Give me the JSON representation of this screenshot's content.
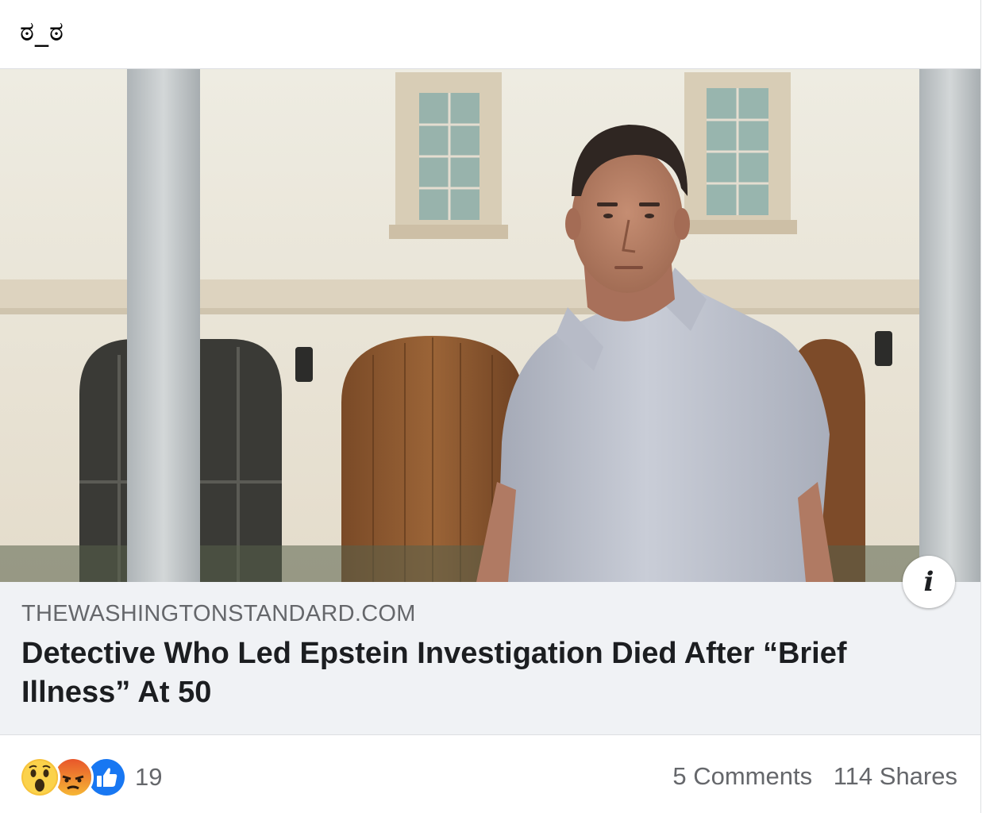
{
  "post": {
    "text": "ಠ_ಠ"
  },
  "link": {
    "domain": "THEWASHINGTONSTANDARD.COM",
    "title": "Detective Who Led Epstein Investigation Died After “Brief Illness” At 50",
    "info_glyph": "i"
  },
  "reactions": {
    "types": [
      "wow-icon",
      "angry-icon",
      "like-icon"
    ],
    "count": "19"
  },
  "counts": {
    "comments": "5 Comments",
    "shares": "114 Shares"
  },
  "colors": {
    "meta_background": "#f0f2f5",
    "secondary_text": "#65676b",
    "like_blue": "#1877f2"
  }
}
